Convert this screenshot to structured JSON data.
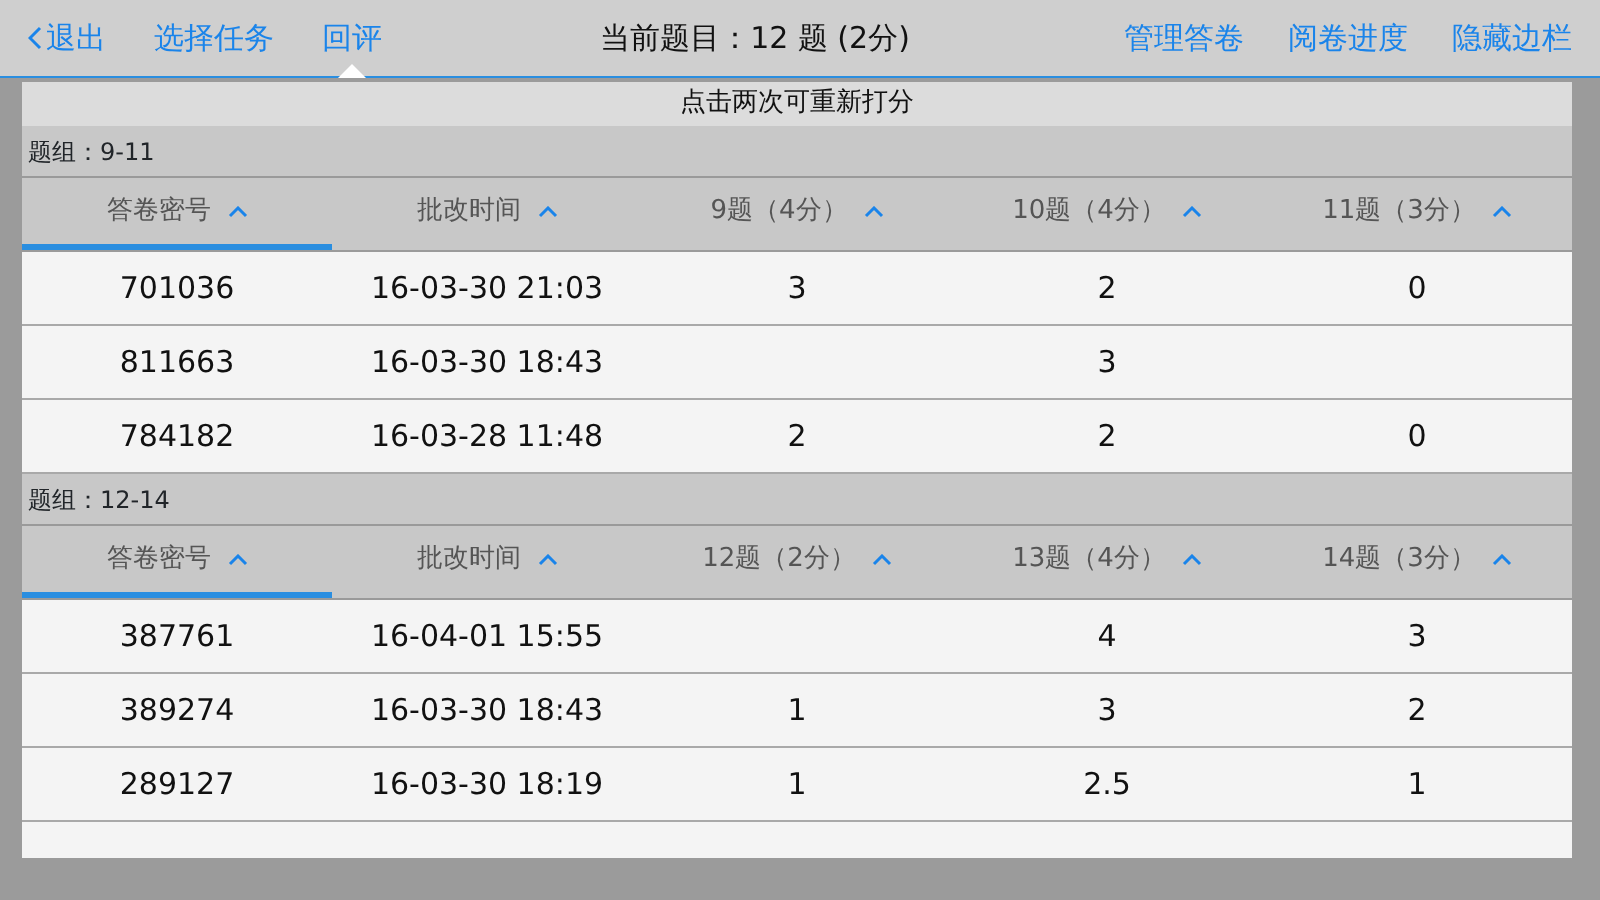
{
  "top_bar": {
    "left_items": [
      {
        "label": "退出",
        "kind": "back",
        "selected": false
      },
      {
        "label": "选择任务",
        "kind": "link",
        "selected": false
      },
      {
        "label": "回评",
        "kind": "link",
        "selected": true
      }
    ],
    "title": "当前题目：12 题 (2分)",
    "right_items": [
      "管理答卷",
      "阅卷进度",
      "隐藏边栏"
    ]
  },
  "notice": "点击两次可重新打分",
  "groups": [
    {
      "label": "题组：9-11",
      "columns": [
        {
          "label": "答卷密号",
          "selected": true
        },
        {
          "label": "批改时间",
          "selected": false
        },
        {
          "label": "9题（4分）",
          "selected": false
        },
        {
          "label": "10题（4分）",
          "selected": false
        },
        {
          "label": "11题（3分）",
          "selected": false
        }
      ],
      "rows": [
        [
          "701036",
          "16-03-30 21:03",
          "3",
          "2",
          "0"
        ],
        [
          "811663",
          "16-03-30 18:43",
          "",
          "3",
          ""
        ],
        [
          "784182",
          "16-03-28 11:48",
          "2",
          "2",
          "0"
        ]
      ]
    },
    {
      "label": "题组：12-14",
      "columns": [
        {
          "label": "答卷密号",
          "selected": true
        },
        {
          "label": "批改时间",
          "selected": false
        },
        {
          "label": "12题（2分）",
          "selected": false
        },
        {
          "label": "13题（4分）",
          "selected": false
        },
        {
          "label": "14题（3分）",
          "selected": false
        }
      ],
      "rows": [
        [
          "387761",
          "16-04-01 15:55",
          "",
          "4",
          "3"
        ],
        [
          "389274",
          "16-03-30 18:43",
          "1",
          "3",
          "2"
        ],
        [
          "289127",
          "16-03-30 18:19",
          "1",
          "2.5",
          "1"
        ]
      ]
    }
  ]
}
